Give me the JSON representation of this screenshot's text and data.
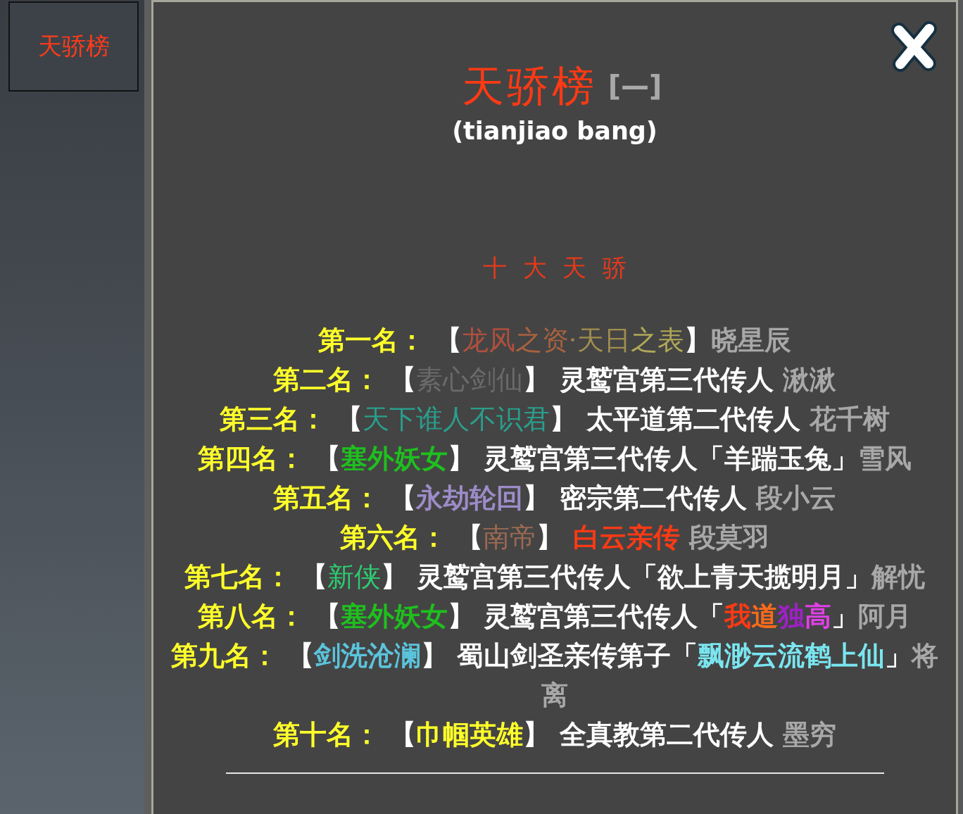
{
  "sidebar": {
    "items": [
      {
        "label": "天骄榜"
      }
    ]
  },
  "panel": {
    "title": "天骄榜",
    "collapse_toggle": "[—]",
    "subtitle": "(tianjiao bang)",
    "section_heading": "十 大 天 骄",
    "rankings": [
      {
        "parts": [
          {
            "text": "第一名：",
            "kind": "bold",
            "color": "#ffff2a"
          },
          {
            "text": " 【",
            "kind": "bold",
            "color": "#ffffff"
          },
          {
            "text": "龙风",
            "kind": "script",
            "color": "#b0503e"
          },
          {
            "text": "之资",
            "kind": "script",
            "color": "#a8623e"
          },
          {
            "text": "·",
            "kind": "script",
            "color": "#9c7c52"
          },
          {
            "text": "天日",
            "kind": "script",
            "color": "#a08e4e"
          },
          {
            "text": "之表",
            "kind": "script",
            "color": "#b0a858"
          },
          {
            "text": "】",
            "kind": "bold",
            "color": "#ffffff"
          },
          {
            "text": "晓星辰",
            "kind": "bold",
            "color": "#a8a8a8"
          }
        ]
      },
      {
        "parts": [
          {
            "text": "第二名：",
            "kind": "bold",
            "color": "#ffff2a"
          },
          {
            "text": " 【",
            "kind": "bold",
            "color": "#ffffff"
          },
          {
            "text": "素心剑仙",
            "kind": "script",
            "color": "#6a6a6a"
          },
          {
            "text": "】 灵鹫宫第三代传人 ",
            "kind": "bold",
            "color": "#ffffff"
          },
          {
            "text": "湫湫",
            "kind": "bold",
            "color": "#a8a8a8"
          }
        ]
      },
      {
        "parts": [
          {
            "text": "第三名：",
            "kind": "bold",
            "color": "#ffff2a"
          },
          {
            "text": " 【",
            "kind": "bold",
            "color": "#ffffff"
          },
          {
            "text": "天下谁人不识君",
            "kind": "script",
            "color": "#2a9e8c"
          },
          {
            "text": "】 太平道第二代传人 ",
            "kind": "bold",
            "color": "#ffffff"
          },
          {
            "text": "花千树",
            "kind": "bold",
            "color": "#a8a8a8"
          }
        ]
      },
      {
        "parts": [
          {
            "text": "第四名：",
            "kind": "bold",
            "color": "#ffff2a"
          },
          {
            "text": " 【",
            "kind": "bold",
            "color": "#ffffff"
          },
          {
            "text": "塞外妖女",
            "kind": "bold",
            "color": "#1fbf1f"
          },
          {
            "text": "】 灵鹫宫第三代传人「羊踹玉兔」",
            "kind": "bold",
            "color": "#ffffff"
          },
          {
            "text": "雪风",
            "kind": "bold",
            "color": "#a8a8a8"
          }
        ]
      },
      {
        "parts": [
          {
            "text": "第五名：",
            "kind": "bold",
            "color": "#ffff2a"
          },
          {
            "text": " 【",
            "kind": "bold",
            "color": "#ffffff"
          },
          {
            "text": "永劫轮回",
            "kind": "bold",
            "color": "#9d8cc8"
          },
          {
            "text": "】 密宗第二代传人 ",
            "kind": "bold",
            "color": "#ffffff"
          },
          {
            "text": "段小云",
            "kind": "bold",
            "color": "#a8a8a8"
          }
        ]
      },
      {
        "parts": [
          {
            "text": "第六名：",
            "kind": "bold",
            "color": "#ffff2a"
          },
          {
            "text": " 【",
            "kind": "bold",
            "color": "#ffffff"
          },
          {
            "text": "南帝",
            "kind": "script",
            "color": "#9c6a52"
          },
          {
            "text": "】 ",
            "kind": "bold",
            "color": "#ffffff"
          },
          {
            "text": "白云亲传",
            "kind": "bold",
            "color": "#ff3a14"
          },
          {
            "text": " 段莫羽",
            "kind": "bold",
            "color": "#a8a8a8"
          }
        ]
      },
      {
        "parts": [
          {
            "text": "第七名：",
            "kind": "bold",
            "color": "#ffff2a"
          },
          {
            "text": " 【",
            "kind": "bold",
            "color": "#ffffff"
          },
          {
            "text": "新侠",
            "kind": "script",
            "color": "#2ecc71"
          },
          {
            "text": "】 灵鹫宫第三代传人「欲上青天揽明月」",
            "kind": "bold",
            "color": "#ffffff"
          },
          {
            "text": "解忧",
            "kind": "bold",
            "color": "#a8a8a8"
          }
        ]
      },
      {
        "parts": [
          {
            "text": "第八名：",
            "kind": "bold",
            "color": "#ffff2a"
          },
          {
            "text": " 【",
            "kind": "bold",
            "color": "#ffffff"
          },
          {
            "text": "塞外妖女",
            "kind": "bold",
            "color": "#1fbf1f"
          },
          {
            "text": "】 灵鹫宫第三代传人「",
            "kind": "bold",
            "color": "#ffffff"
          },
          {
            "text": "我",
            "kind": "bold",
            "color": "#ff3a14"
          },
          {
            "text": "道",
            "kind": "bold",
            "color": "#ff6a1a"
          },
          {
            "text": "独",
            "kind": "bold",
            "color": "#a020c8"
          },
          {
            "text": "高",
            "kind": "bold",
            "color": "#e040e8"
          },
          {
            "text": "」",
            "kind": "bold",
            "color": "#ffffff"
          },
          {
            "text": "阿月",
            "kind": "bold",
            "color": "#a8a8a8"
          }
        ]
      },
      {
        "parts": [
          {
            "text": "第九名：",
            "kind": "bold",
            "color": "#ffff2a"
          },
          {
            "text": " 【",
            "kind": "bold",
            "color": "#ffffff"
          },
          {
            "text": "剑洗沧澜",
            "kind": "bold",
            "color": "#5bc4dc"
          },
          {
            "text": "】 蜀山剑圣亲传第子「",
            "kind": "bold",
            "color": "#ffffff"
          },
          {
            "text": "飘渺云流鹤上仙",
            "kind": "bold",
            "color": "#7ae6f0"
          },
          {
            "text": "」",
            "kind": "bold",
            "color": "#ffffff"
          },
          {
            "text": "将离",
            "kind": "bold",
            "color": "#a8a8a8"
          }
        ]
      },
      {
        "parts": [
          {
            "text": "第十名：",
            "kind": "bold",
            "color": "#ffff2a"
          },
          {
            "text": " 【",
            "kind": "bold",
            "color": "#ffffff"
          },
          {
            "text": "巾帼英雄",
            "kind": "bold",
            "color": "#ffff2a"
          },
          {
            "text": "】 全真教第二代传人 ",
            "kind": "bold",
            "color": "#ffffff"
          },
          {
            "text": "墨穷",
            "kind": "bold",
            "color": "#a8a8a8"
          }
        ]
      }
    ]
  }
}
